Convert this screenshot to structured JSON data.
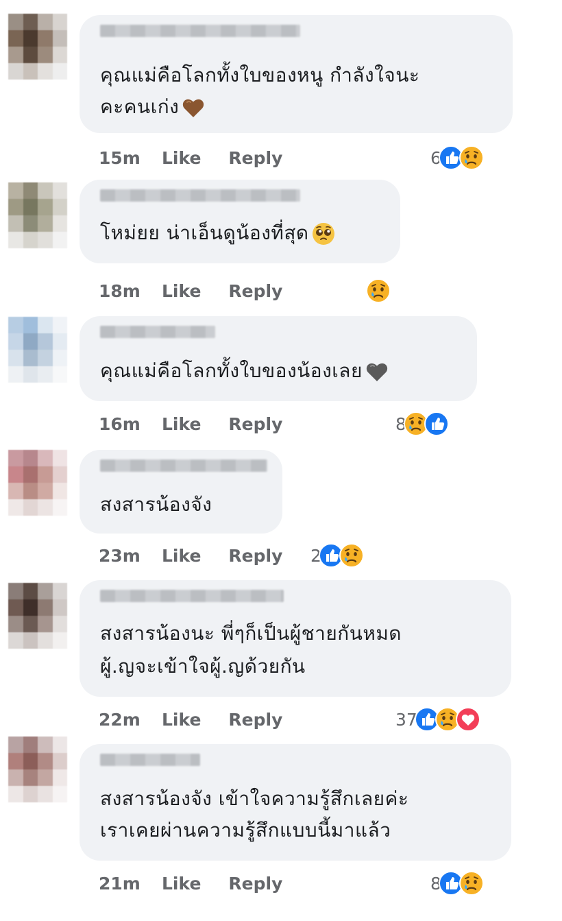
{
  "comments": [
    {
      "text_lines": [
        "คุณแม่คือโลกทั้งใบของหนู กำลังใจนะ",
        "คะคนเก่ง"
      ],
      "inline_emoji": "brown-heart-icon",
      "time": "15m",
      "like_label": "Like",
      "reply_label": "Reply",
      "reaction_count": "6",
      "reaction_icons": [
        "like-icon",
        "sad-icon"
      ],
      "avatar_colors": [
        "#9a8f85",
        "#6e5e52",
        "#b9b0a8",
        "#d8d4d0",
        "#7a6554",
        "#4b3a2e",
        "#8f7a6a",
        "#c4beb9",
        "#a89a8e",
        "#5d4b3e",
        "#9c8b7d",
        "#dcd8d4",
        "#d9d6d3",
        "#c9c1ba",
        "#e3e0dd",
        "#eeeeee"
      ]
    },
    {
      "text_lines": [
        "โหม่ยย น่าเอ็นดูน้องที่สุด"
      ],
      "inline_emoji": "pleading-face-icon",
      "time": "18m",
      "like_label": "Like",
      "reply_label": "Reply",
      "reaction_count": "",
      "reaction_icons": [
        "sad-icon"
      ],
      "avatar_colors": [
        "#b8b2a2",
        "#8f8a76",
        "#c9c6bb",
        "#e2e0dc",
        "#9e9a84",
        "#77775f",
        "#a6a48e",
        "#d3d1c8",
        "#c2bfb4",
        "#8c8c78",
        "#b1ae9c",
        "#e6e4e0",
        "#e8e7e4",
        "#d6d4cd",
        "#e1dfdb",
        "#f2f2f2"
      ]
    },
    {
      "text_lines": [
        "คุณแม่คือโลกทั้งใบของน้องเลย"
      ],
      "inline_emoji": "grey-heart-icon",
      "time": "16m",
      "like_label": "Like",
      "reply_label": "Reply",
      "reaction_count": "8",
      "reaction_icons": [
        "sad-icon",
        "like-icon"
      ],
      "avatar_colors": [
        "#b7cde3",
        "#a0bedc",
        "#dbe6f0",
        "#f0f3f7",
        "#c6d6e7",
        "#8fa9c4",
        "#b5c7da",
        "#e4ebf2",
        "#d8e2ec",
        "#a9bccf",
        "#c4d2e0",
        "#eef2f6",
        "#eef1f4",
        "#dfe5eb",
        "#e9edf1",
        "#f7f8f9"
      ]
    },
    {
      "text_lines": [
        "สงสารน้องจัง"
      ],
      "inline_emoji": "",
      "time": "23m",
      "like_label": "Like",
      "reply_label": "Reply",
      "reaction_count": "2",
      "reaction_icons": [
        "like-icon",
        "sad-icon"
      ],
      "avatar_colors": [
        "#c99aa0",
        "#b7878d",
        "#d9b8bb",
        "#efe3e4",
        "#c8868b",
        "#a9706f",
        "#c79b95",
        "#e4d0cf",
        "#d8b7b3",
        "#b98d85",
        "#d0aaa3",
        "#f0e6e4",
        "#efe8e7",
        "#e2d6d4",
        "#ece4e3",
        "#f7f4f4"
      ]
    },
    {
      "text_lines": [
        "สงสารน้องนะ พี่ๆก็เป็นผู้ชายกันหมด",
        "ผู้.ญจะเข้าใจผู้.ญด้วยกัน"
      ],
      "inline_emoji": "",
      "time": "22m",
      "like_label": "Like",
      "reply_label": "Reply",
      "reaction_count": "37",
      "reaction_icons": [
        "like-icon",
        "sad-icon",
        "love-icon"
      ],
      "avatar_colors": [
        "#8a7d78",
        "#5c4c45",
        "#a99f9a",
        "#d9d5d3",
        "#6f5a52",
        "#3f2f2a",
        "#8d7a72",
        "#cfc8c5",
        "#9b8d87",
        "#6b5a53",
        "#a6958f",
        "#e2dedc",
        "#dcd8d6",
        "#cbc3c0",
        "#e3dfdd",
        "#f2f0ef"
      ]
    },
    {
      "text_lines": [
        "สงสารน้องจัง เข้าใจความรู้สึกเลยค่ะ",
        "เราเคยผ่านความรู้สึกแบบนี้มาแล้ว"
      ],
      "inline_emoji": "",
      "time": "21m",
      "like_label": "Like",
      "reply_label": "Reply",
      "reaction_count": "8",
      "reaction_icons": [
        "like-icon",
        "sad-icon"
      ],
      "avatar_colors": [
        "#b8a3a3",
        "#a07e7c",
        "#cdbcbb",
        "#ece6e6",
        "#b0807c",
        "#8c5e59",
        "#b18b86",
        "#dccdcb",
        "#c9b2af",
        "#a7837e",
        "#c3a7a2",
        "#efe8e7",
        "#ede7e6",
        "#ddd2d0",
        "#e9e2e1",
        "#f6f3f3"
      ]
    }
  ]
}
